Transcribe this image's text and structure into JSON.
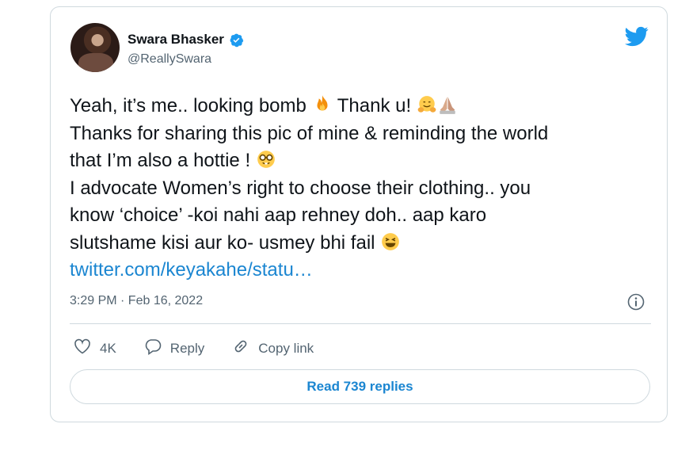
{
  "author": {
    "name": "Swara Bhasker",
    "handle": "@ReallySwara"
  },
  "icons": {
    "verified": "verified-badge-icon",
    "brand": "twitter-bird-icon",
    "info": "info-icon",
    "like": "heart-icon",
    "reply": "reply-bubble-icon",
    "copy": "link-chain-icon",
    "emoji": [
      "fire",
      "hugging-face",
      "folded-hands",
      "nerd-face",
      "laughing-face"
    ]
  },
  "tweet": {
    "line1a": "Yeah, it’s me.. looking bomb ",
    "line1b": " Thank u! ",
    "line2": "Thanks for sharing this pic of mine & reminding the world",
    "line3": "that I’m also a hottie ! ",
    "line4": "I advocate Women’s right to choose their clothing.. you",
    "line5": "know ‘choice’ -koi nahi aap rehney doh.. aap karo",
    "line6": "slutshame kisi aur ko- usmey bhi fail ",
    "link": "twitter.com/keyakahe/statu…"
  },
  "timestamp": "3:29 PM · Feb 16, 2022",
  "actions": {
    "likes": "4K",
    "reply_label": "Reply",
    "copy_label": "Copy link"
  },
  "read_replies_label": "Read 739 replies",
  "colors": {
    "link": "#1b86d1",
    "twitter_blue": "#1d9bf0",
    "text": "#0f1419",
    "muted": "#536471",
    "border": "#cfd9de"
  }
}
